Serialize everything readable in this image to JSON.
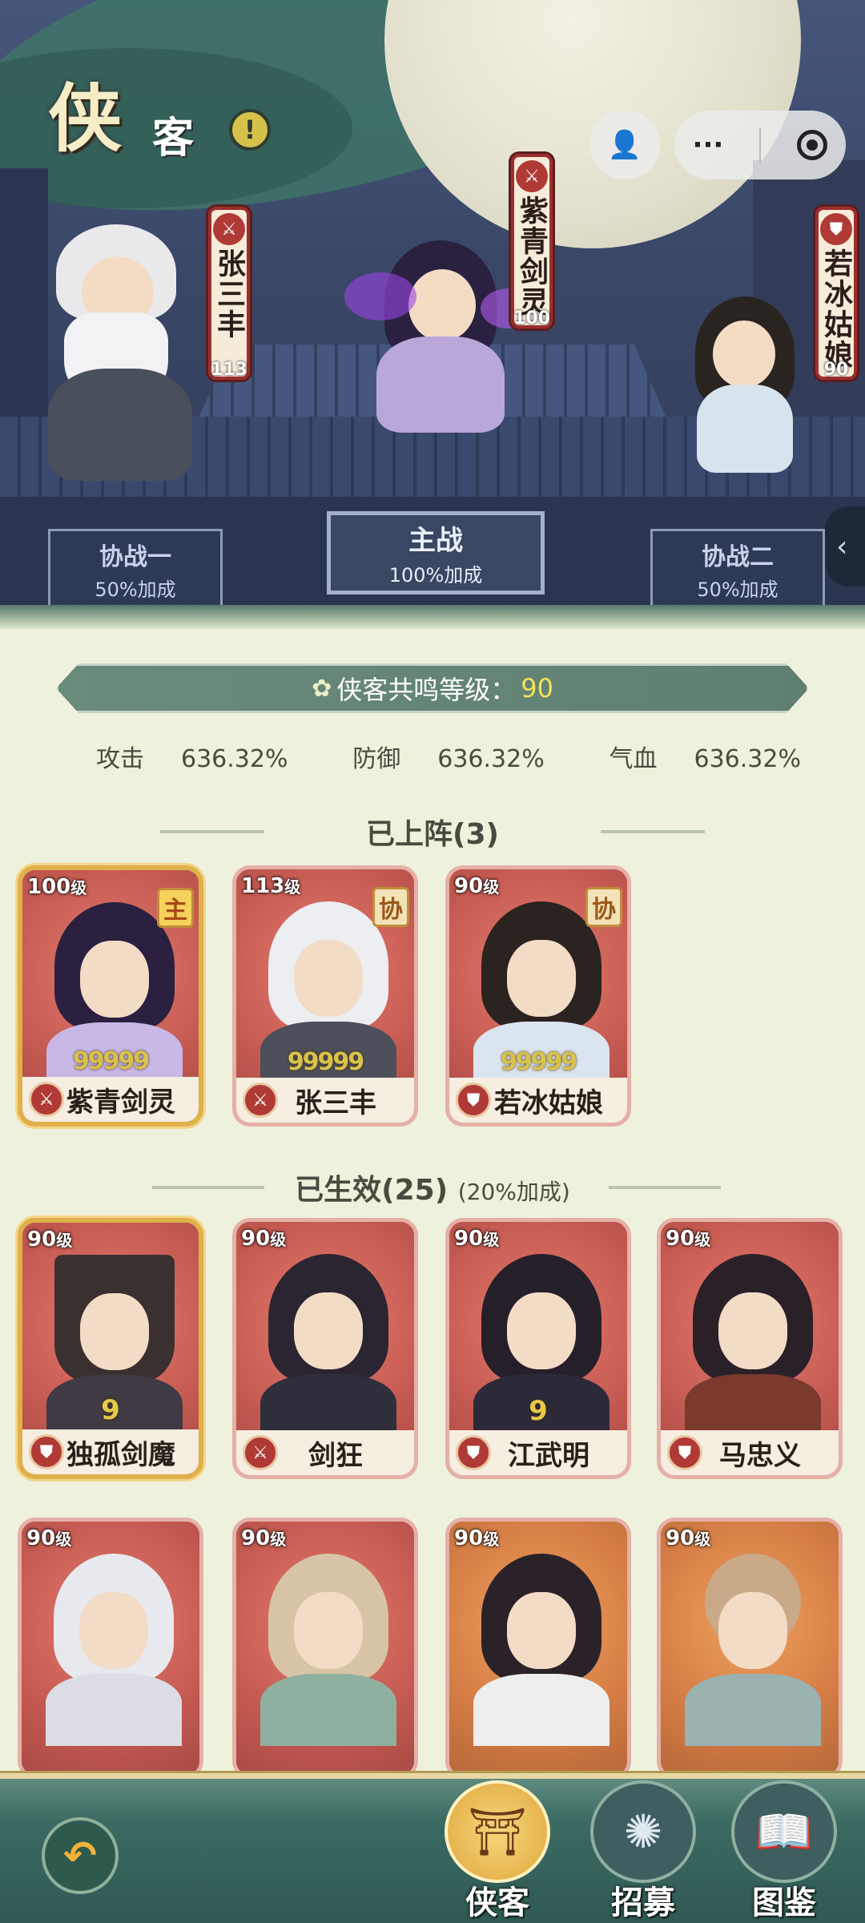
{
  "header": {
    "title_big": "侠",
    "title_small": "客",
    "info_icon": "exclaim-icon"
  },
  "lineup": {
    "left": {
      "name": "张三丰",
      "level": "113",
      "class_icon": "sword-icon"
    },
    "center": {
      "name": "紫青剑灵",
      "level": "100",
      "class_icon": "sword-icon"
    },
    "right": {
      "name": "若冰姑娘",
      "level": "90",
      "class_icon": "shield-icon"
    }
  },
  "slots": {
    "assist1": {
      "title": "协战一",
      "bonus": "50%加成"
    },
    "main": {
      "title": "主战",
      "bonus": "100%加成"
    },
    "assist2": {
      "title": "协战二",
      "bonus": "50%加成"
    }
  },
  "resonance": {
    "label": "侠客共鸣等级：",
    "value": "90"
  },
  "stats": [
    {
      "label": "攻击",
      "value": "636.32%"
    },
    {
      "label": "防御",
      "value": "636.32%"
    },
    {
      "label": "气血",
      "value": "636.32%"
    }
  ],
  "sections": {
    "deployed": "已上阵(3)",
    "active": "已生效(25)",
    "active_sub": "(20%加成)"
  },
  "deployed_cards": [
    {
      "level": "100",
      "unit": "级",
      "role": "主",
      "stars": "99999",
      "name": "紫青剑灵",
      "class_icon": "sword-icon"
    },
    {
      "level": "113",
      "unit": "级",
      "role": "协",
      "stars": "99999",
      "name": "张三丰",
      "class_icon": "sword-icon"
    },
    {
      "level": "90",
      "unit": "级",
      "role": "协",
      "stars": "99999",
      "name": "若冰姑娘",
      "class_icon": "shield-icon"
    }
  ],
  "active_cards": [
    {
      "level": "90",
      "unit": "级",
      "tier": "9",
      "name": "独孤剑魔",
      "class_icon": "shield-icon"
    },
    {
      "level": "90",
      "unit": "级",
      "tier": "",
      "name": "剑狂",
      "class_icon": "sword-icon"
    },
    {
      "level": "90",
      "unit": "级",
      "tier": "9",
      "name": "江武明",
      "class_icon": "shield-icon"
    },
    {
      "level": "90",
      "unit": "级",
      "tier": "",
      "name": "马忠义",
      "class_icon": "shield-icon"
    },
    {
      "level": "90",
      "unit": "级",
      "name": ""
    },
    {
      "level": "90",
      "unit": "级",
      "name": ""
    },
    {
      "level": "90",
      "unit": "级",
      "name": ""
    },
    {
      "level": "90",
      "unit": "级",
      "name": ""
    }
  ],
  "nav": [
    {
      "label": "侠客",
      "icon": "hero-hat-icon",
      "active": true
    },
    {
      "label": "招募",
      "icon": "recruit-swirl-icon",
      "active": false
    },
    {
      "label": "图鉴",
      "icon": "book-icon",
      "active": false
    }
  ],
  "colors": {
    "card_red": "#c05a52",
    "gold": "#e0b04a",
    "accent_yellow": "#f4e15b"
  }
}
